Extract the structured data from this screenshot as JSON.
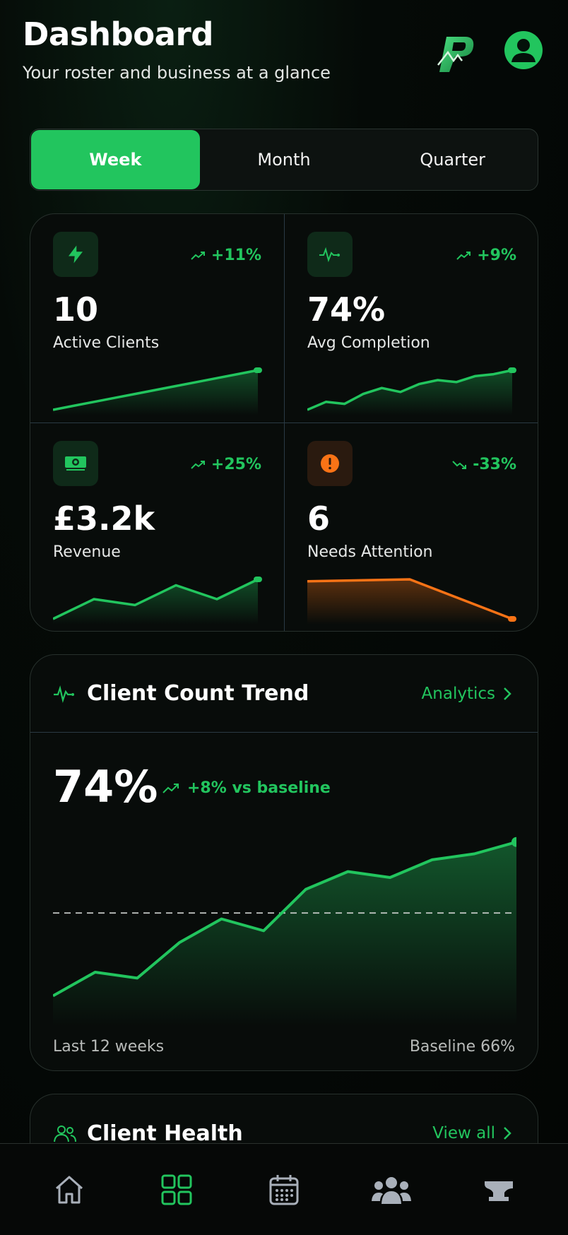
{
  "header": {
    "title": "Dashboard",
    "subtitle": "Your roster and business at a glance"
  },
  "period_tabs": [
    {
      "label": "Week",
      "active": true
    },
    {
      "label": "Month",
      "active": false
    },
    {
      "label": "Quarter",
      "active": false
    }
  ],
  "stats": [
    {
      "icon": "bolt-icon",
      "change": "+11%",
      "trend": "up",
      "value": "10",
      "label": "Active Clients",
      "color": "#22c55e",
      "spark": [
        0,
        0.1,
        0.2,
        0.3,
        0.4,
        0.5,
        0.6,
        0.7,
        0.8,
        0.9,
        1.0
      ]
    },
    {
      "icon": "activity-icon",
      "change": "+9%",
      "trend": "up",
      "value": "74%",
      "label": "Avg Completion",
      "color": "#22c55e",
      "spark": [
        0,
        0.2,
        0.15,
        0.4,
        0.55,
        0.45,
        0.65,
        0.75,
        0.7,
        0.85,
        0.9,
        1.0
      ]
    },
    {
      "icon": "cash-icon",
      "change": "+25%",
      "trend": "up",
      "value": "£3.2k",
      "label": "Revenue",
      "color": "#22c55e",
      "spark": [
        0,
        0.5,
        0.35,
        0.85,
        0.5,
        1.0
      ]
    },
    {
      "icon": "alert-icon",
      "change": "-33%",
      "trend": "down",
      "value": "6",
      "label": "Needs Attention",
      "color": "#f97316",
      "spark": [
        0.95,
        1.0,
        0.0
      ]
    }
  ],
  "trend_card": {
    "title": "Client Count Trend",
    "link": "Analytics",
    "value": "74%",
    "change": "+8% vs baseline",
    "footer_left": "Last 12 weeks",
    "footer_right": "Baseline 66%"
  },
  "chart_data": {
    "type": "line",
    "title": "Client Count Trend",
    "x": [
      1,
      2,
      3,
      4,
      5,
      6,
      7,
      8,
      9,
      10,
      11,
      12
    ],
    "series": [
      {
        "values": [
          52,
          56,
          55,
          61,
          65,
          63,
          70,
          73,
          72,
          75,
          76,
          78
        ]
      }
    ],
    "baseline": 66,
    "ylim": [
      48,
      80
    ],
    "grid": false,
    "accent": "#22c55e"
  },
  "health_card": {
    "title": "Client Health",
    "link": "View all"
  },
  "bottom_nav": [
    {
      "icon": "home-icon",
      "active": false
    },
    {
      "icon": "grid-icon",
      "active": true
    },
    {
      "icon": "calendar-icon",
      "active": false
    },
    {
      "icon": "users-icon",
      "active": false
    },
    {
      "icon": "anvil-icon",
      "active": false
    }
  ],
  "colors": {
    "accent": "#22c55e",
    "warning": "#f97316",
    "inactive_icon": "#a9b0ba"
  }
}
